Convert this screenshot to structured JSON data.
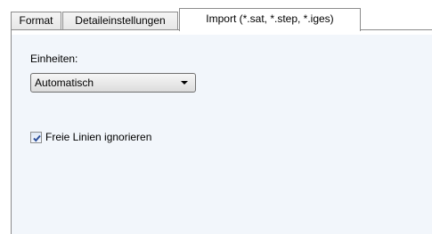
{
  "tabs": [
    {
      "label": "Format",
      "active": false
    },
    {
      "label": "Detaileinstellungen",
      "active": false
    },
    {
      "label": "Import (*.sat, *.step, *.iges)",
      "active": true
    }
  ],
  "units": {
    "label": "Einheiten:",
    "selected": "Automatisch"
  },
  "options": {
    "ignore_free_lines": {
      "label": "Freie Linien ignorieren",
      "checked": true
    }
  },
  "colors": {
    "panel_background": "#f2f6fb",
    "tab_border": "#8c8c8c",
    "check_mark": "#2b4e9a"
  },
  "icons": {
    "dropdown": "chevron-down-icon",
    "check": "checkmark-icon"
  }
}
